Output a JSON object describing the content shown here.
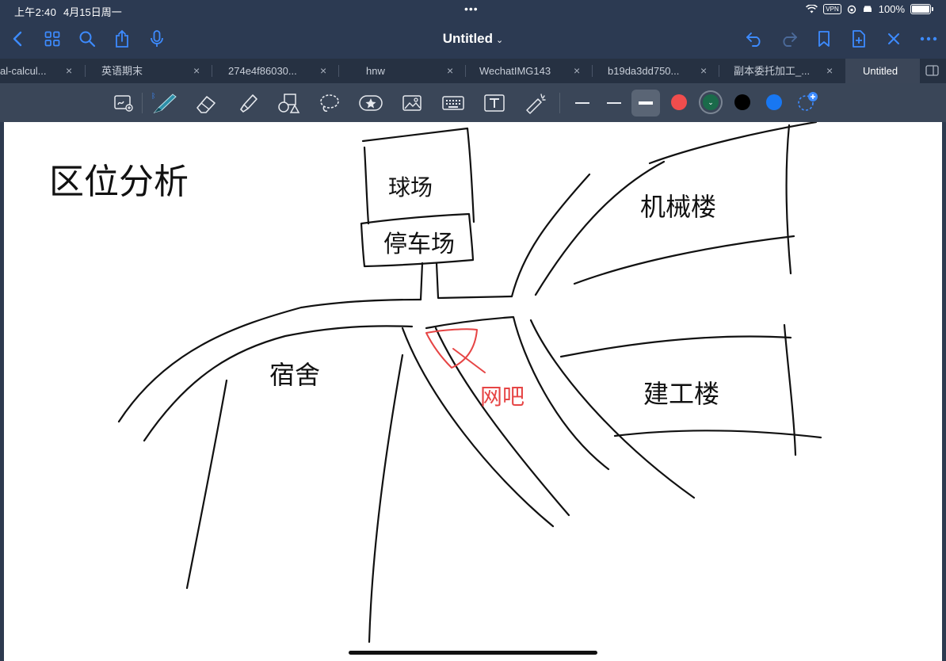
{
  "status_bar": {
    "time": "上午2:40",
    "date": "4月15日周一",
    "vpn": "VPN",
    "battery": "100%"
  },
  "nav": {
    "title": "Untitled",
    "icons": [
      "back-icon",
      "grid-icon",
      "search-icon",
      "share-icon",
      "microphone-icon",
      "undo-icon",
      "redo-icon",
      "bookmark-icon",
      "add-page-icon",
      "close-icon",
      "more-icon"
    ]
  },
  "tabs": [
    {
      "label": "al-calcul...",
      "close": "×"
    },
    {
      "label": "英语期末",
      "close": "×"
    },
    {
      "label": "274e4f86030...",
      "close": "×"
    },
    {
      "label": "hnw",
      "close": "×"
    },
    {
      "label": "WechatIMG143",
      "close": "×"
    },
    {
      "label": "b19da3dd750...",
      "close": "×"
    },
    {
      "label": "副本委托加工_...",
      "close": "×"
    },
    {
      "label": "Untitled",
      "close": ""
    }
  ],
  "toolbar": {
    "tools": [
      "selection-icon",
      "pen-icon",
      "eraser-icon",
      "highlighter-icon",
      "shapes-icon",
      "lasso-icon",
      "sticker-icon",
      "image-icon",
      "keyboard-icon",
      "text-icon",
      "laser-pointer-icon"
    ],
    "colors": [
      "#f04d4d",
      "#1a6b4a",
      "#000000",
      "#1877f2"
    ]
  },
  "canvas": {
    "title_text": "区位分析",
    "labels": {
      "ballfield": "球场",
      "parking": "停车场",
      "mech_building": "机械楼",
      "dorm": "宿舍",
      "civil_building": "建工楼",
      "internet_cafe": "网吧"
    }
  }
}
